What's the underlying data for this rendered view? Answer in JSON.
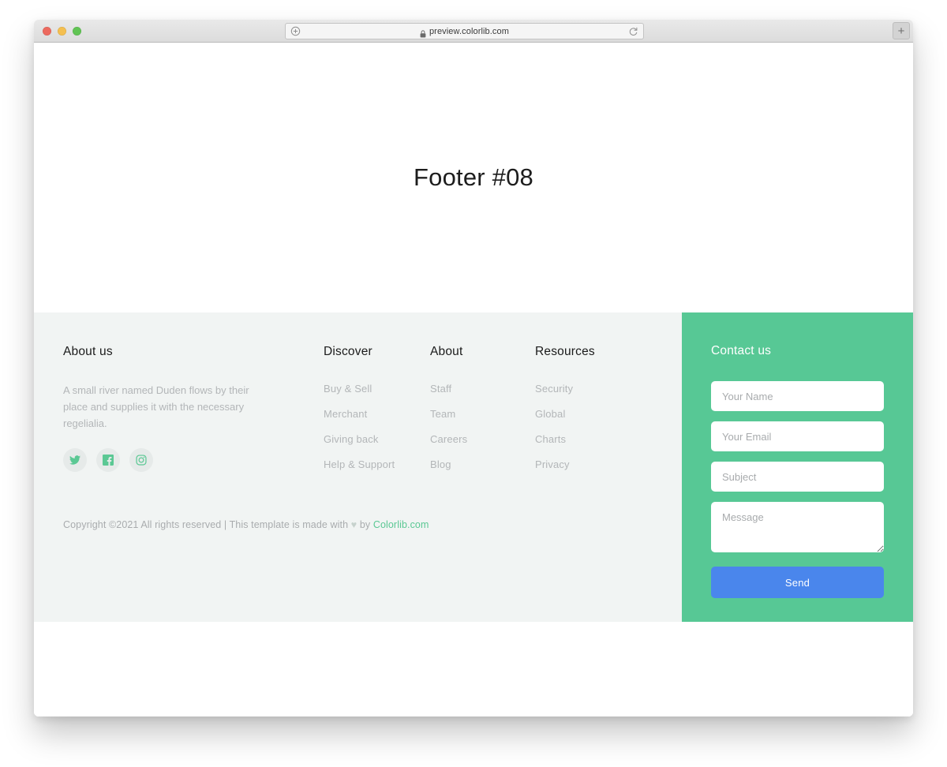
{
  "browser": {
    "traffic_lights": [
      "close",
      "minimize",
      "maximize"
    ],
    "url": "preview.colorlib.com",
    "left_icon": "circled-plus-icon",
    "right_icon": "reload-icon",
    "lock_icon": "lock-icon",
    "new_tab_label": "+"
  },
  "hero": {
    "title": "Footer #08"
  },
  "footer": {
    "about": {
      "heading": "About us",
      "text": "A small river named Duden flows by their place and supplies it with the necessary regelialia.",
      "social": [
        {
          "name": "twitter-icon",
          "label": "Twitter"
        },
        {
          "name": "facebook-icon",
          "label": "Facebook"
        },
        {
          "name": "instagram-icon",
          "label": "Instagram"
        }
      ]
    },
    "columns": [
      {
        "heading": "Discover",
        "links": [
          "Buy & Sell",
          "Merchant",
          "Giving back",
          "Help & Support"
        ]
      },
      {
        "heading": "About",
        "links": [
          "Staff",
          "Team",
          "Careers",
          "Blog"
        ]
      },
      {
        "heading": "Resources",
        "links": [
          "Security",
          "Global",
          "Charts",
          "Privacy"
        ]
      }
    ],
    "copyright": {
      "prefix": "Copyright ©2021 All rights reserved | This template is made with ",
      "heart": "♥",
      "middle": " by ",
      "brand": "Colorlib.com"
    },
    "contact": {
      "heading": "Contact us",
      "name_placeholder": "Your Name",
      "email_placeholder": "Your Email",
      "subject_placeholder": "Subject",
      "message_placeholder": "Message",
      "send_label": "Send"
    }
  },
  "colors": {
    "accent_green": "#57c895",
    "footer_bg": "#f1f4f3",
    "send_blue": "#4a86ec",
    "muted_text": "#b3b6b8"
  }
}
